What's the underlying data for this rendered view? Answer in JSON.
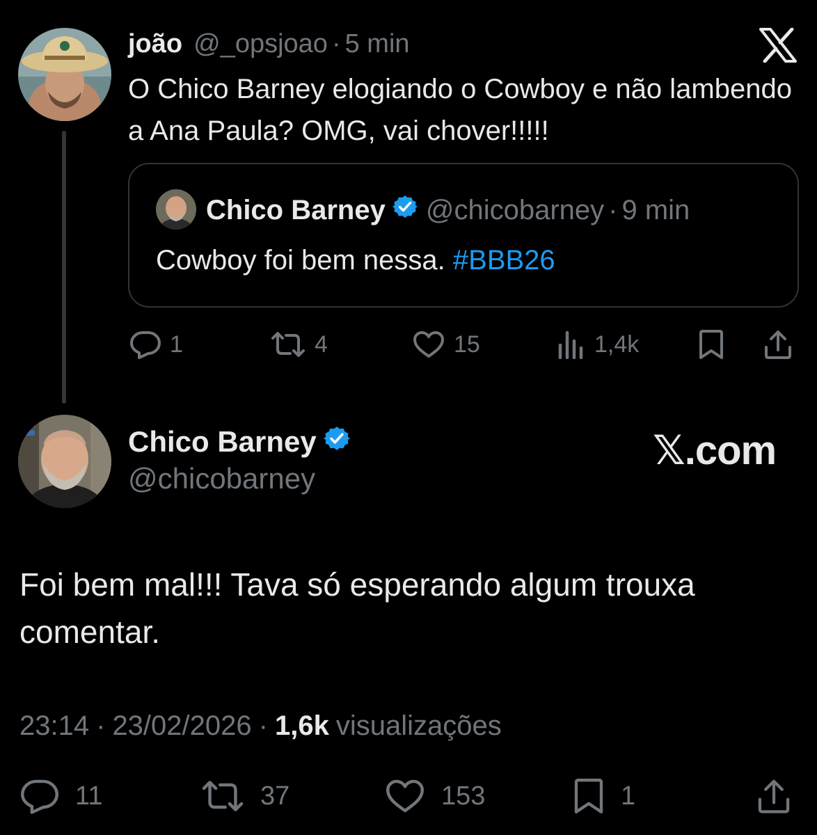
{
  "parent": {
    "name": "joão",
    "handle": "@_opsjoao",
    "separator": "·",
    "time": "5 min",
    "text": "O Chico Barney elogiando o Cowboy e não lambendo a Ana Paula? OMG, vai chover!!!!!",
    "quote": {
      "name": "Chico Barney",
      "handle": "@chicobarney",
      "separator": "·",
      "time": "9 min",
      "text": "Cowboy foi bem nessa.",
      "hashtag": "#BBB26"
    },
    "actions": {
      "replies": "1",
      "reposts": "4",
      "likes": "15",
      "views": "1,4k"
    }
  },
  "main": {
    "name": "Chico Barney",
    "handle": "@chicobarney",
    "watermark": "𝕏.com",
    "text": "Foi bem mal!!! Tava só esperando algum trouxa comentar.",
    "time": "23:14",
    "separator": "·",
    "date": "23/02/2026",
    "views_count": "1,6k",
    "views_label": "visualizações",
    "actions": {
      "replies": "11",
      "reposts": "37",
      "likes": "153",
      "bookmarks": "1"
    }
  },
  "colors": {
    "background": "#000000",
    "text": "#e7e9ea",
    "muted": "#71767b",
    "link": "#1d9bf0",
    "verified": "#1d9bf0",
    "border": "#2f3336"
  },
  "icons": [
    "x-logo-icon",
    "verified-badge-icon",
    "reply-icon",
    "repost-icon",
    "like-icon",
    "views-icon",
    "bookmark-icon",
    "share-icon"
  ]
}
